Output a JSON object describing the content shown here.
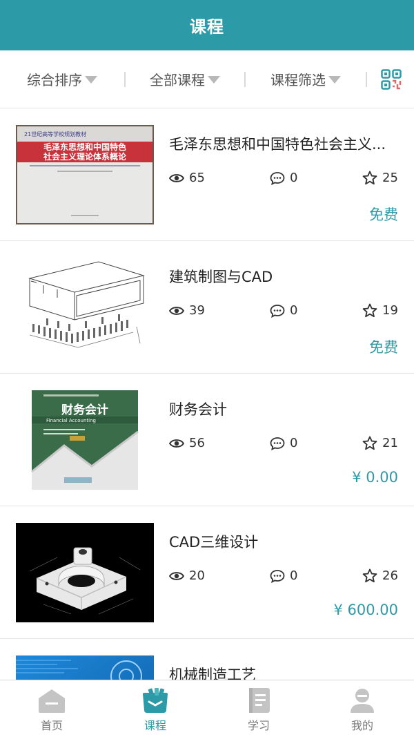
{
  "header": {
    "title": "课程"
  },
  "filters": [
    {
      "label": "综合排序"
    },
    {
      "label": "全部课程"
    },
    {
      "label": "课程筛选"
    }
  ],
  "courses": [
    {
      "title": "毛泽东思想和中国特色社会主义...",
      "views": "65",
      "comments": "0",
      "stars": "25",
      "price": "免费",
      "thumb": {
        "name": "maozedong-book-cover",
        "banner_line1": "毛泽东思想和中国特色",
        "banner_line2": "社会主义理论体系概论"
      }
    },
    {
      "title": "建筑制图与CAD",
      "views": "39",
      "comments": "0",
      "stars": "19",
      "price": "免费",
      "thumb": {
        "name": "architecture-drawing"
      }
    },
    {
      "title": "财务会计",
      "views": "56",
      "comments": "0",
      "stars": "21",
      "price": "¥ 0.00",
      "thumb": {
        "name": "accounting-book-cover",
        "cover_title": "财务会计",
        "cover_subtitle": "Financial Accounting"
      }
    },
    {
      "title": "CAD三维设计",
      "views": "20",
      "comments": "0",
      "stars": "26",
      "price": "¥ 600.00",
      "thumb": {
        "name": "cad-3d-part"
      }
    },
    {
      "title": "机械制造工艺",
      "views": "",
      "comments": "",
      "stars": "",
      "price": "",
      "thumb": {
        "name": "mechanical-blue-image"
      }
    }
  ],
  "tabbar": {
    "items": [
      {
        "label": "首页",
        "icon": "home-icon",
        "active": false
      },
      {
        "label": "课程",
        "icon": "course-icon",
        "active": true
      },
      {
        "label": "学习",
        "icon": "study-icon",
        "active": false
      },
      {
        "label": "我的",
        "icon": "profile-icon",
        "active": false
      }
    ]
  },
  "colors": {
    "accent": "#2c9ba7",
    "inactive": "#c4c4c4"
  }
}
